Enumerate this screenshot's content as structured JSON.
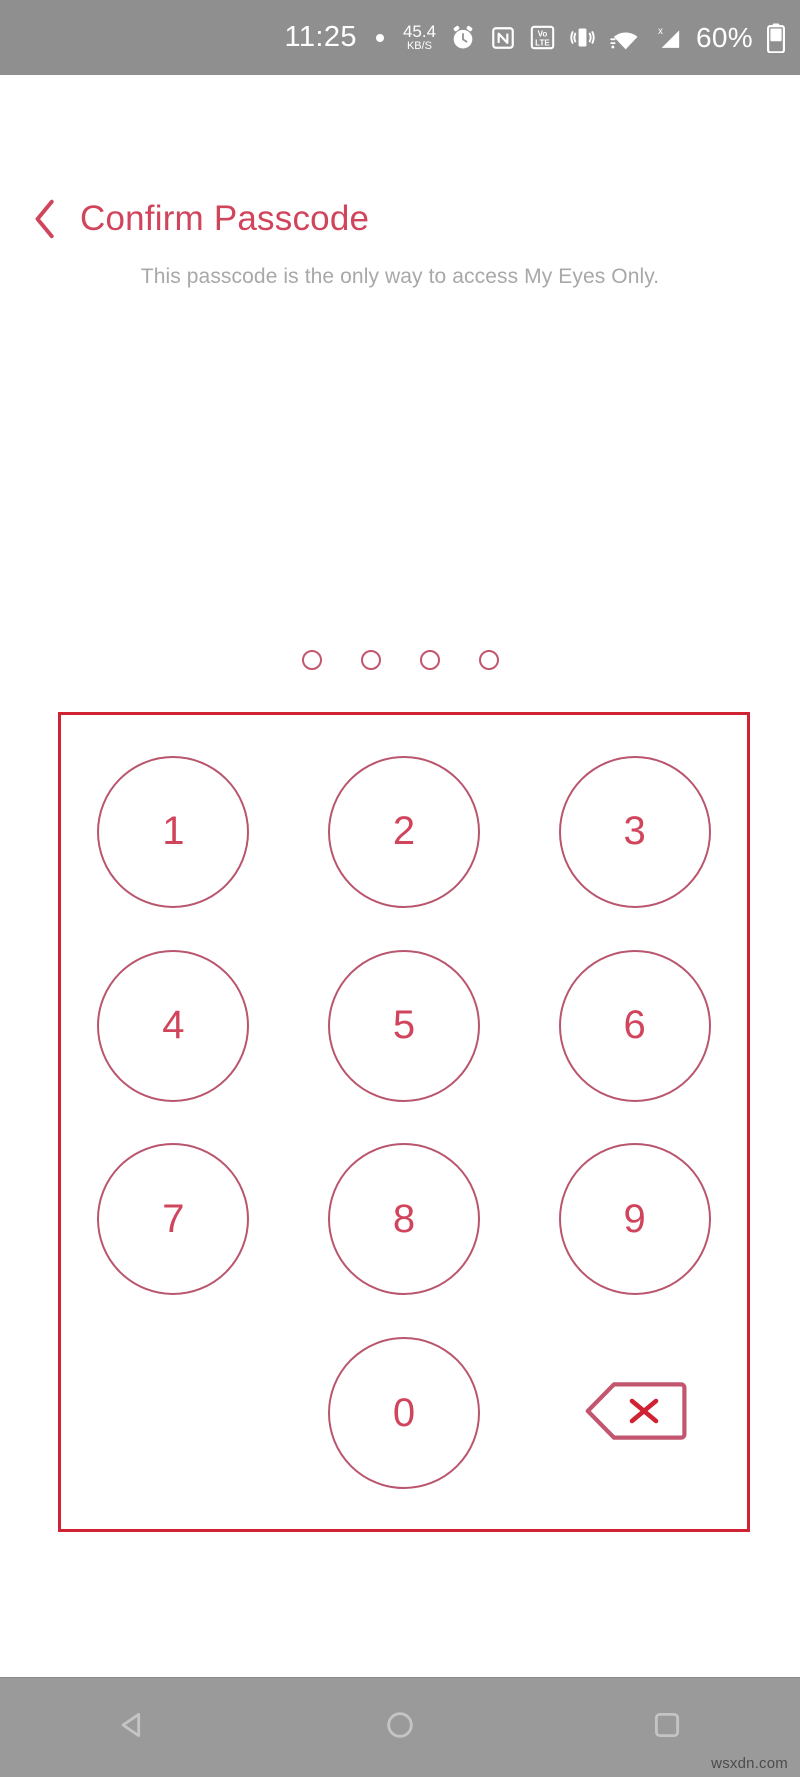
{
  "status_bar": {
    "time": "11:25",
    "dot_icon": "dot-icon",
    "network_speed": {
      "value": "45.4",
      "unit": "KB/S"
    },
    "icons": [
      "alarm-icon",
      "nfc-icon",
      "volte-icon",
      "vibrate-icon",
      "wifi-icon",
      "cellular-signal-icon"
    ],
    "battery_percent": "60%",
    "battery_icon": "battery-icon",
    "background_color": "#8f8f8f"
  },
  "header": {
    "back_icon": "chevron-left-icon",
    "title": "Confirm Passcode",
    "title_color": "#d1455c"
  },
  "subtitle": {
    "text": "This passcode is the only way to access My Eyes Only.",
    "color": "#a8a8a8"
  },
  "passcode": {
    "length": 4,
    "entered": 0,
    "dot_color": "#c2566f",
    "dots": [
      "empty",
      "empty",
      "empty",
      "empty"
    ]
  },
  "keypad": {
    "frame_color": "#cf2233",
    "key_border_color": "#b9566d",
    "digit_color": "#d1455c",
    "keys": [
      {
        "label": "1",
        "name": "key-1",
        "type": "digit"
      },
      {
        "label": "2",
        "name": "key-2",
        "type": "digit"
      },
      {
        "label": "3",
        "name": "key-3",
        "type": "digit"
      },
      {
        "label": "4",
        "name": "key-4",
        "type": "digit"
      },
      {
        "label": "5",
        "name": "key-5",
        "type": "digit"
      },
      {
        "label": "6",
        "name": "key-6",
        "type": "digit"
      },
      {
        "label": "7",
        "name": "key-7",
        "type": "digit"
      },
      {
        "label": "8",
        "name": "key-8",
        "type": "digit"
      },
      {
        "label": "9",
        "name": "key-9",
        "type": "digit"
      },
      {
        "label": "",
        "name": "key-blank",
        "type": "blank"
      },
      {
        "label": "0",
        "name": "key-0",
        "type": "digit"
      },
      {
        "label": "",
        "name": "key-backspace",
        "type": "backspace"
      }
    ],
    "backspace_icon": "backspace-delete-icon"
  },
  "nav_bar": {
    "background_color": "#9a9a9a",
    "buttons": [
      {
        "name": "nav-back-button",
        "icon": "triangle-back-icon"
      },
      {
        "name": "nav-home-button",
        "icon": "circle-home-icon"
      },
      {
        "name": "nav-recents-button",
        "icon": "square-recents-icon"
      }
    ]
  },
  "watermark": {
    "text": "wsxdn.com"
  }
}
